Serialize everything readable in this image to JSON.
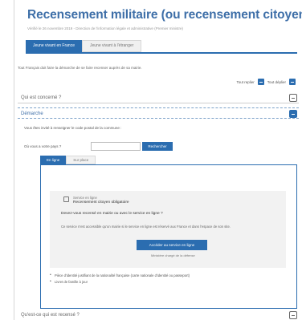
{
  "page": {
    "title": "Recensement militaire (ou recensement citoyen)",
    "subtitle": "Vérifié le 26 novembre 2019 - Direction de l'information légale et administrative (Premier ministre)"
  },
  "main_tabs": [
    {
      "label": "Jeune vivant en France",
      "active": true
    },
    {
      "label": "Jeune vivant à l'étranger",
      "active": false
    }
  ],
  "intro": "Tout Français doit faire la démarche de se faire recenser auprès de sa mairie.",
  "expand_controls": {
    "expand_all": "Tout replier",
    "collapse_all": "Tout déplier"
  },
  "sections": [
    {
      "label": "Qui est concerné ?"
    },
    {
      "label": "Démarche"
    },
    {
      "label": "Qu'est-ce qui est recensé ?"
    }
  ],
  "demarche": {
    "instruction": "Vous êtes invité à renseigner le code postal de la commune :",
    "cp_label": "Où vous a votre pays ?",
    "cp_placeholder": "",
    "search_button": "Rechercher",
    "sub_tabs": [
      {
        "label": "En ligne",
        "active": true
      },
      {
        "label": "Sur place",
        "active": false
      }
    ]
  },
  "service": {
    "type_label": "Service en ligne",
    "name": "Recensement citoyen obligatoire",
    "question": "Devez-vous recensé en mairie ou avec le service en ligne ?",
    "description": "Ce service n'est accessible qu'un mairie si le service en ligne est réservé aux France et dans l'espace de son site.",
    "button": "Accéder au service en ligne",
    "note": "Ministère chargé de la défense"
  },
  "bullets": [
    "Pièce d'identité justifiant de la nationalité française (carte nationale d'identité ou passeport)",
    "Livret de famille à jour"
  ],
  "colors": {
    "accent": "#2b6db0",
    "title": "#3e6fa8"
  }
}
